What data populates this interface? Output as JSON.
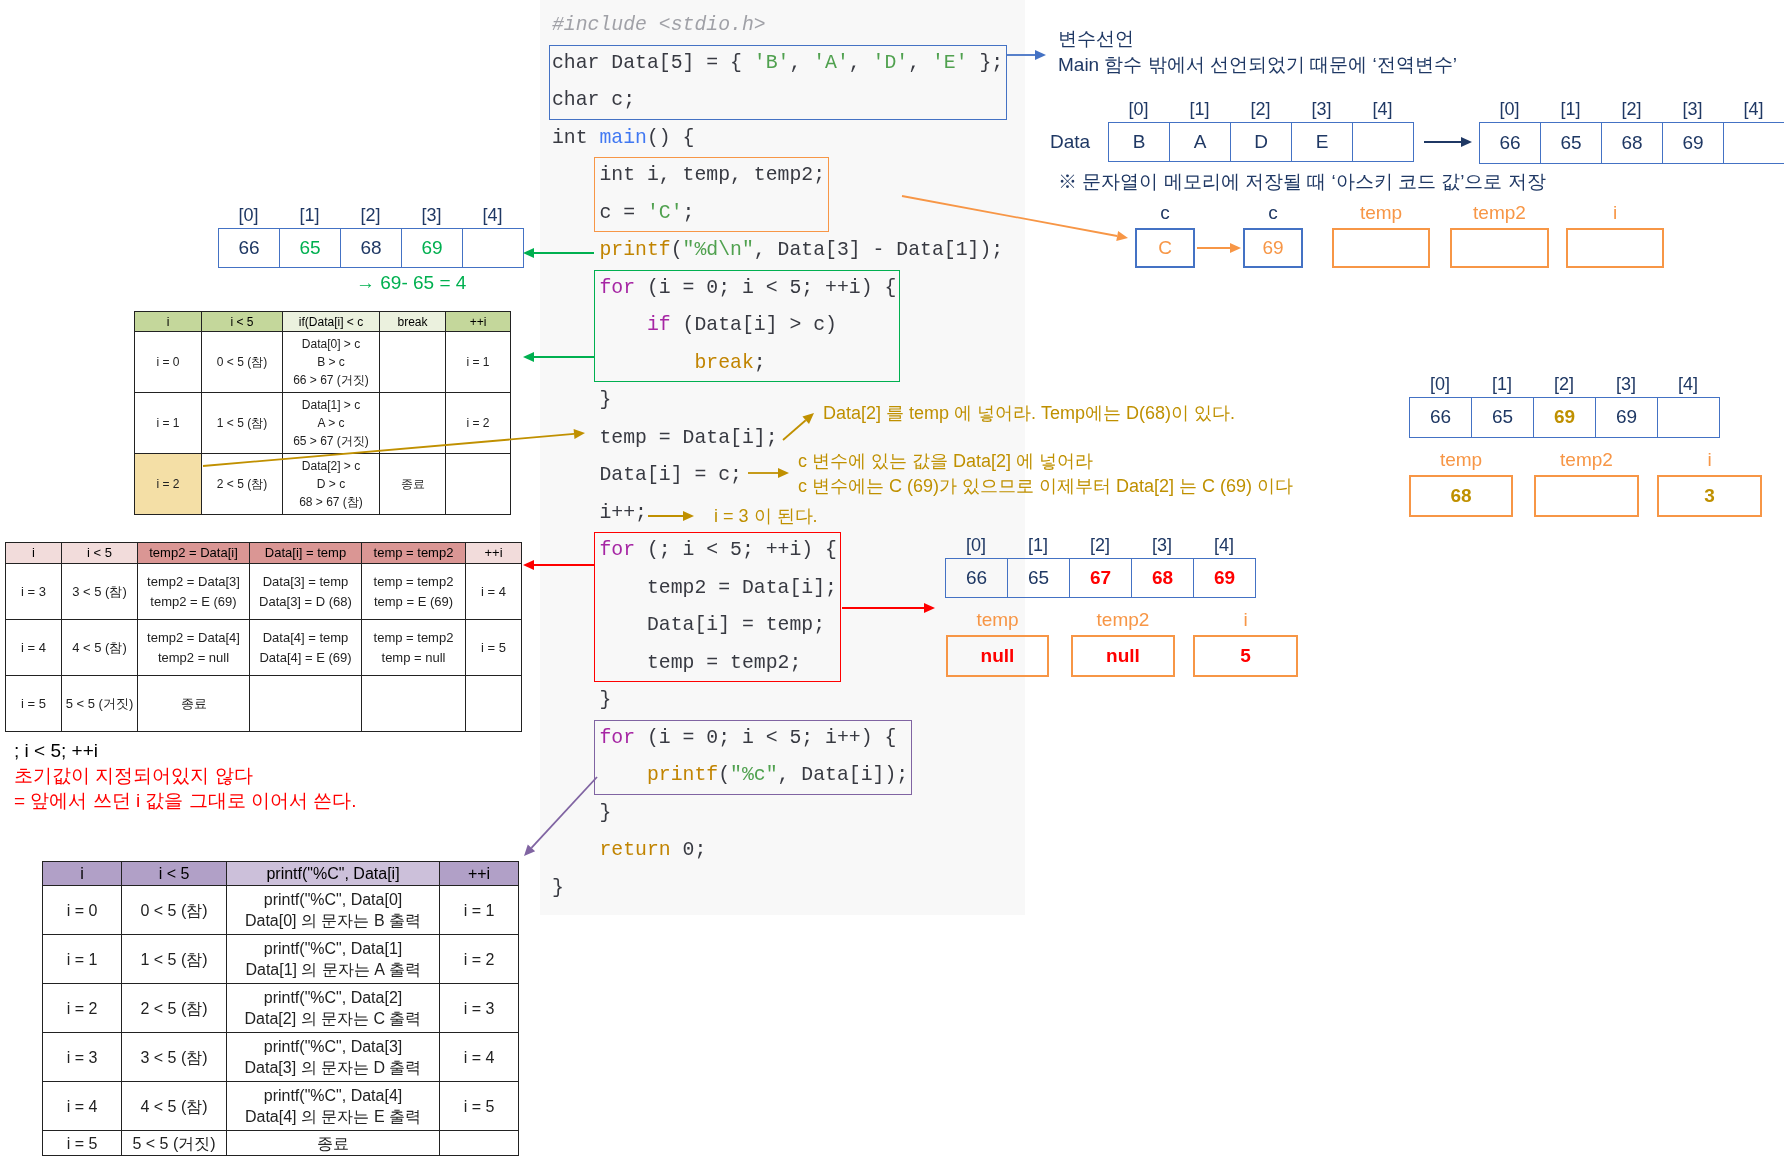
{
  "code": {
    "blocks": [
      {
        "kind": "plain",
        "indented": false,
        "lines": [
          {
            "tokens": [
              {
                "text": "#include <stdio.h>",
                "kind": "comment"
              }
            ]
          }
        ]
      },
      {
        "kind": "boxed",
        "color": "#4472c4",
        "indented": false,
        "lines": [
          {
            "tokens": [
              {
                "text": "char Data[5] = { ",
                "kind": "plain"
              },
              {
                "text": "'B'",
                "kind": "string"
              },
              {
                "text": ", ",
                "kind": "plain"
              },
              {
                "text": "'A'",
                "kind": "string"
              },
              {
                "text": ", ",
                "kind": "plain"
              },
              {
                "text": "'D'",
                "kind": "string"
              },
              {
                "text": ", ",
                "kind": "plain"
              },
              {
                "text": "'E'",
                "kind": "string"
              },
              {
                "text": " };",
                "kind": "plain"
              }
            ]
          },
          {
            "tokens": [
              {
                "text": "char c;",
                "kind": "plain"
              }
            ]
          }
        ]
      },
      {
        "kind": "plain",
        "indented": false,
        "lines": [
          {
            "tokens": [
              {
                "text": "int ",
                "kind": "plain"
              },
              {
                "text": "main",
                "kind": "func"
              },
              {
                "text": "() {",
                "kind": "plain"
              }
            ]
          }
        ]
      },
      {
        "kind": "boxed",
        "color": "#f79646",
        "indented": true,
        "lines": [
          {
            "tokens": [
              {
                "text": "int i, temp, temp2;",
                "kind": "plain"
              }
            ]
          },
          {
            "tokens": [
              {
                "text": "c = ",
                "kind": "plain"
              },
              {
                "text": "'C'",
                "kind": "string"
              },
              {
                "text": ";",
                "kind": "plain"
              }
            ]
          }
        ]
      },
      {
        "kind": "plain",
        "indented": true,
        "lines": [
          {
            "tokens": [
              {
                "text": "printf",
                "kind": "builtin"
              },
              {
                "text": "(",
                "kind": "plain"
              },
              {
                "text": "\"%d\\n\"",
                "kind": "string"
              },
              {
                "text": ", Data[3] - Data[1]);",
                "kind": "plain"
              }
            ]
          }
        ]
      },
      {
        "kind": "boxed",
        "color": "#00b050",
        "indented": true,
        "lines": [
          {
            "tokens": [
              {
                "text": "for",
                "kind": "keyword"
              },
              {
                "text": " (i = 0; i < 5; ++i) {",
                "kind": "plain"
              }
            ],
            "children": [
              {
                "tokens": [
                  {
                    "text": "if",
                    "kind": "keyword"
                  },
                  {
                    "text": " (Data[i] > c)",
                    "kind": "plain"
                  }
                ],
                "children": [
                  {
                    "tokens": [
                      {
                        "text": "break",
                        "kind": "builtin"
                      },
                      {
                        "text": ";",
                        "kind": "plain"
                      }
                    ]
                  }
                ]
              }
            ]
          }
        ]
      },
      {
        "kind": "plain",
        "indented": true,
        "lines": [
          {
            "tokens": [
              {
                "text": "}",
                "kind": "plain"
              }
            ]
          },
          {
            "tokens": [
              {
                "text": "temp = Data[i];",
                "kind": "plain"
              }
            ]
          },
          {
            "tokens": [
              {
                "text": "Data[i] = c;",
                "kind": "plain"
              }
            ]
          },
          {
            "tokens": [
              {
                "text": "i++;",
                "kind": "plain"
              }
            ]
          }
        ]
      },
      {
        "kind": "boxed",
        "color": "#ff0000",
        "indented": true,
        "lines": [
          {
            "tokens": [
              {
                "text": "for",
                "kind": "keyword"
              },
              {
                "text": " (; i < 5; ++i) {",
                "kind": "plain"
              }
            ],
            "children": [
              {
                "tokens": [
                  {
                    "text": "temp2 = Data[i];",
                    "kind": "plain"
                  }
                ]
              },
              {
                "tokens": [
                  {
                    "text": "Data[i] = temp;",
                    "kind": "plain"
                  }
                ]
              },
              {
                "tokens": [
                  {
                    "text": "temp = temp2;",
                    "kind": "plain"
                  }
                ]
              }
            ]
          }
        ]
      },
      {
        "kind": "plain",
        "indented": true,
        "lines": [
          {
            "tokens": [
              {
                "text": "}",
                "kind": "plain"
              }
            ]
          }
        ]
      },
      {
        "kind": "boxed",
        "color": "#8064a2",
        "indented": true,
        "lines": [
          {
            "tokens": [
              {
                "text": "for",
                "kind": "keyword"
              },
              {
                "text": " (i = 0; i < 5; i++) {",
                "kind": "plain"
              }
            ],
            "children": [
              {
                "tokens": [
                  {
                    "text": "printf",
                    "kind": "builtin"
                  },
                  {
                    "text": "(",
                    "kind": "plain"
                  },
                  {
                    "text": "\"%c\"",
                    "kind": "string"
                  },
                  {
                    "text": ", Data[i]);",
                    "kind": "plain"
                  }
                ]
              }
            ]
          }
        ]
      },
      {
        "kind": "plain",
        "indented": true,
        "lines": [
          {
            "tokens": [
              {
                "text": "}",
                "kind": "plain"
              }
            ]
          },
          {
            "tokens": [
              {
                "text": "return",
                "kind": "builtin"
              },
              {
                "text": " 0;",
                "kind": "plain"
              }
            ]
          }
        ]
      },
      {
        "kind": "plain",
        "indented": false,
        "lines": [
          {
            "tokens": [
              {
                "text": "}",
                "kind": "plain"
              }
            ]
          }
        ]
      }
    ]
  },
  "declaration_note": {
    "title": "변수선언",
    "text": "Main 함수 밖에서 선언되었기 때문에 ‘전역변수’"
  },
  "data_array": {
    "label": "Data",
    "indices": [
      "[0]",
      "[1]",
      "[2]",
      "[3]",
      "[4]"
    ],
    "cells": [
      {
        "kind": "value",
        "text": "B",
        "color": "#1f3864",
        "bold": false
      },
      {
        "kind": "value",
        "text": "A",
        "color": "#1f3864",
        "bold": false
      },
      {
        "kind": "value",
        "text": "D",
        "color": "#1f3864",
        "bold": false
      },
      {
        "kind": "value",
        "text": "E",
        "color": "#1f3864",
        "bold": false
      },
      {
        "kind": "empty"
      }
    ]
  },
  "ascii_array": {
    "indices": [
      "[0]",
      "[1]",
      "[2]",
      "[3]",
      "[4]"
    ],
    "cells": [
      {
        "kind": "value",
        "text": "66",
        "color": "#1f3864",
        "bold": false
      },
      {
        "kind": "value",
        "text": "65",
        "color": "#1f3864",
        "bold": false
      },
      {
        "kind": "value",
        "text": "68",
        "color": "#1f3864",
        "bold": false
      },
      {
        "kind": "value",
        "text": "69",
        "color": "#1f3864",
        "bold": false
      },
      {
        "kind": "empty"
      }
    ]
  },
  "ascii_note": "※ 문자열이 메모리에 저장될 때 ‘아스키 코드 값’으로 저장",
  "variables_initial": [
    {
      "kind": "global",
      "label": "c",
      "value": "C",
      "color": "#f79646",
      "bold": false
    },
    {
      "kind": "global",
      "label": "c",
      "value": "69",
      "color": "#f79646",
      "bold": false
    },
    {
      "kind": "local",
      "label": "temp"
    },
    {
      "kind": "local",
      "label": "temp2"
    },
    {
      "kind": "local",
      "label": "i"
    }
  ],
  "printf_array": {
    "indices": [
      "[0]",
      "[1]",
      "[2]",
      "[3]",
      "[4]"
    ],
    "cells": [
      {
        "kind": "value",
        "text": "66",
        "color": "#1f3864",
        "bold": false
      },
      {
        "kind": "value",
        "text": "65",
        "color": "#00b050",
        "bold": false
      },
      {
        "kind": "value",
        "text": "68",
        "color": "#1f3864",
        "bold": false
      },
      {
        "kind": "value",
        "text": "69",
        "color": "#00b050",
        "bold": false
      },
      {
        "kind": "empty"
      }
    ]
  },
  "printf_result": "→ 69- 65 = 4",
  "break_table": {
    "columns": [
      {
        "label": "i",
        "color": "#c4d79b"
      },
      {
        "label": "i < 5",
        "color": "#c4d79b"
      },
      {
        "label": "if(Data[i] < c",
        "color": "#ebf1de"
      },
      {
        "label": "break",
        "color": "#ebf1de"
      },
      {
        "label": "++i",
        "color": "#c4d79b"
      }
    ],
    "rows": [
      {
        "highlighted": false,
        "i": "i = 0",
        "condition": "0 < 5 (참)",
        "if_check": [
          "Data[0] > c",
          "B > c",
          "66 > 67 (거짓)"
        ],
        "increment": "i = 1"
      },
      {
        "highlighted": false,
        "i": "i = 1",
        "condition": "1 < 5 (참)",
        "if_check": [
          "Data[1] > c",
          "A > c",
          "65 > 67 (거짓)"
        ],
        "increment": "i = 2"
      },
      {
        "highlighted": true,
        "i": "i = 2",
        "condition": "2 < 5 (참)",
        "if_check": [
          "Data[2] > c",
          "D > c",
          "68 > 67 (참)"
        ],
        "break": "종료"
      }
    ]
  },
  "swap_notes": {
    "temp_note": "Data[2] 를 temp 에 넣어라. Temp에는 D(68)이 있다.",
    "data_note": [
      "c 변수에 있는 값을 Data[2] 에 넣어라",
      "c 변수에는 C (69)가 있으므로 이제부터 Data[2] 는 C (69) 이다"
    ],
    "increment_note": "i = 3 이 된다."
  },
  "swap_array": {
    "indices": [
      "[0]",
      "[1]",
      "[2]",
      "[3]",
      "[4]"
    ],
    "cells": [
      {
        "kind": "value",
        "text": "66",
        "color": "#1f3864",
        "bold": false
      },
      {
        "kind": "value",
        "text": "65",
        "color": "#1f3864",
        "bold": false
      },
      {
        "kind": "value",
        "text": "69",
        "color": "#bf9000",
        "bold": true
      },
      {
        "kind": "value",
        "text": "69",
        "color": "#1f3864",
        "bold": false
      },
      {
        "kind": "empty"
      }
    ]
  },
  "variables_after_swap": [
    {
      "kind": "local",
      "label": "temp",
      "value": "68",
      "color": "#bf9000",
      "bold": true
    },
    {
      "kind": "local",
      "label": "temp2"
    },
    {
      "kind": "local",
      "label": "i",
      "value": "3",
      "color": "#bf9000",
      "bold": true
    }
  ],
  "shift_table": {
    "columns": [
      {
        "label": "i",
        "color": "#f2dcdb"
      },
      {
        "label": "i < 5",
        "color": "#f2dcdb"
      },
      {
        "label": "temp2 = Data[i]",
        "color": "#da9694"
      },
      {
        "label": "Data[i] = temp",
        "color": "#da9694"
      },
      {
        "label": "temp = temp2",
        "color": "#da9694"
      },
      {
        "label": "++i",
        "color": "#f2dcdb"
      }
    ],
    "rows": [
      {
        "i": "i = 3",
        "condition": "3 < 5 (참)",
        "temp2_assign": [
          "temp2 = Data[3]",
          "temp2 = E (69)"
        ],
        "data_assign": [
          "Data[3] = temp",
          "Data[3] = D (68)"
        ],
        "temp_assign": [
          "temp = temp2",
          "temp = E (69)"
        ],
        "increment": "i = 4"
      },
      {
        "i": "i = 4",
        "condition": "4 < 5 (참)",
        "temp2_assign": [
          "temp2 = Data[4]",
          "temp2 = null"
        ],
        "data_assign": [
          "Data[4] = temp",
          "Data[4] = E (69)"
        ],
        "temp_assign": [
          "temp = temp2",
          "temp = null"
        ],
        "increment": "i = 5"
      },
      {
        "i": "i = 5",
        "condition": "5 < 5 (거짓)",
        "temp2_assign": "종료"
      }
    ]
  },
  "loop_note": {
    "header": "; i < 5; ++i",
    "lines": [
      "초기값이 지정되어있지 않다",
      "= 앞에서 쓰던 i 값을 그대로 이어서 쓴다."
    ]
  },
  "shift_array": {
    "indices": [
      "[0]",
      "[1]",
      "[2]",
      "[3]",
      "[4]"
    ],
    "cells": [
      {
        "kind": "value",
        "text": "66",
        "color": "#1f3864",
        "bold": false
      },
      {
        "kind": "value",
        "text": "65",
        "color": "#1f3864",
        "bold": false
      },
      {
        "kind": "value",
        "text": "67",
        "color": "#ff0000",
        "bold": true
      },
      {
        "kind": "value",
        "text": "68",
        "color": "#ff0000",
        "bold": true
      },
      {
        "kind": "value",
        "text": "69",
        "color": "#ff0000",
        "bold": true
      }
    ]
  },
  "variables_final": [
    {
      "kind": "local",
      "label": "temp",
      "value": "null",
      "color": "#ff0000",
      "bold": true
    },
    {
      "kind": "local",
      "label": "temp2",
      "value": "null",
      "color": "#ff0000",
      "bold": true
    },
    {
      "kind": "local",
      "label": "i",
      "value": "5",
      "color": "#ff0000",
      "bold": true
    }
  ],
  "print_table": {
    "columns": [
      {
        "label": "i",
        "color": "#b1a0c7"
      },
      {
        "label": "i < 5",
        "color": "#b1a0c7"
      },
      {
        "label": "printf(\"%C\", Data[i]",
        "color": "#ccc0da"
      },
      {
        "label": "++i",
        "color": "#b1a0c7"
      }
    ],
    "rows": [
      {
        "i": "i = 0",
        "condition": "0 < 5 (참)",
        "printf": [
          "printf(\"%C\", Data[0]",
          "Data[0] 의 문자는 B 출력"
        ],
        "increment": "i = 1"
      },
      {
        "i": "i = 1",
        "condition": "1 < 5 (참)",
        "printf": [
          "printf(\"%C\", Data[1]",
          "Data[1] 의 문자는 A 출력"
        ],
        "increment": "i = 2"
      },
      {
        "i": "i = 2",
        "condition": "2 < 5 (참)",
        "printf": [
          "printf(\"%C\", Data[2]",
          "Data[2] 의 문자는 C 출력"
        ],
        "increment": "i = 3"
      },
      {
        "i": "i = 3",
        "condition": "3 < 5 (참)",
        "printf": [
          "printf(\"%C\", Data[3]",
          "Data[3] 의 문자는 D 출력"
        ],
        "increment": "i = 4"
      },
      {
        "i": "i = 4",
        "condition": "4 < 5 (참)",
        "printf": [
          "printf(\"%C\", Data[4]",
          "Data[4] 의 문자는 E 출력"
        ],
        "increment": "i = 5"
      },
      {
        "i": "i = 5",
        "condition": "5 < 5 (거짓)",
        "printf": "종료"
      }
    ]
  }
}
